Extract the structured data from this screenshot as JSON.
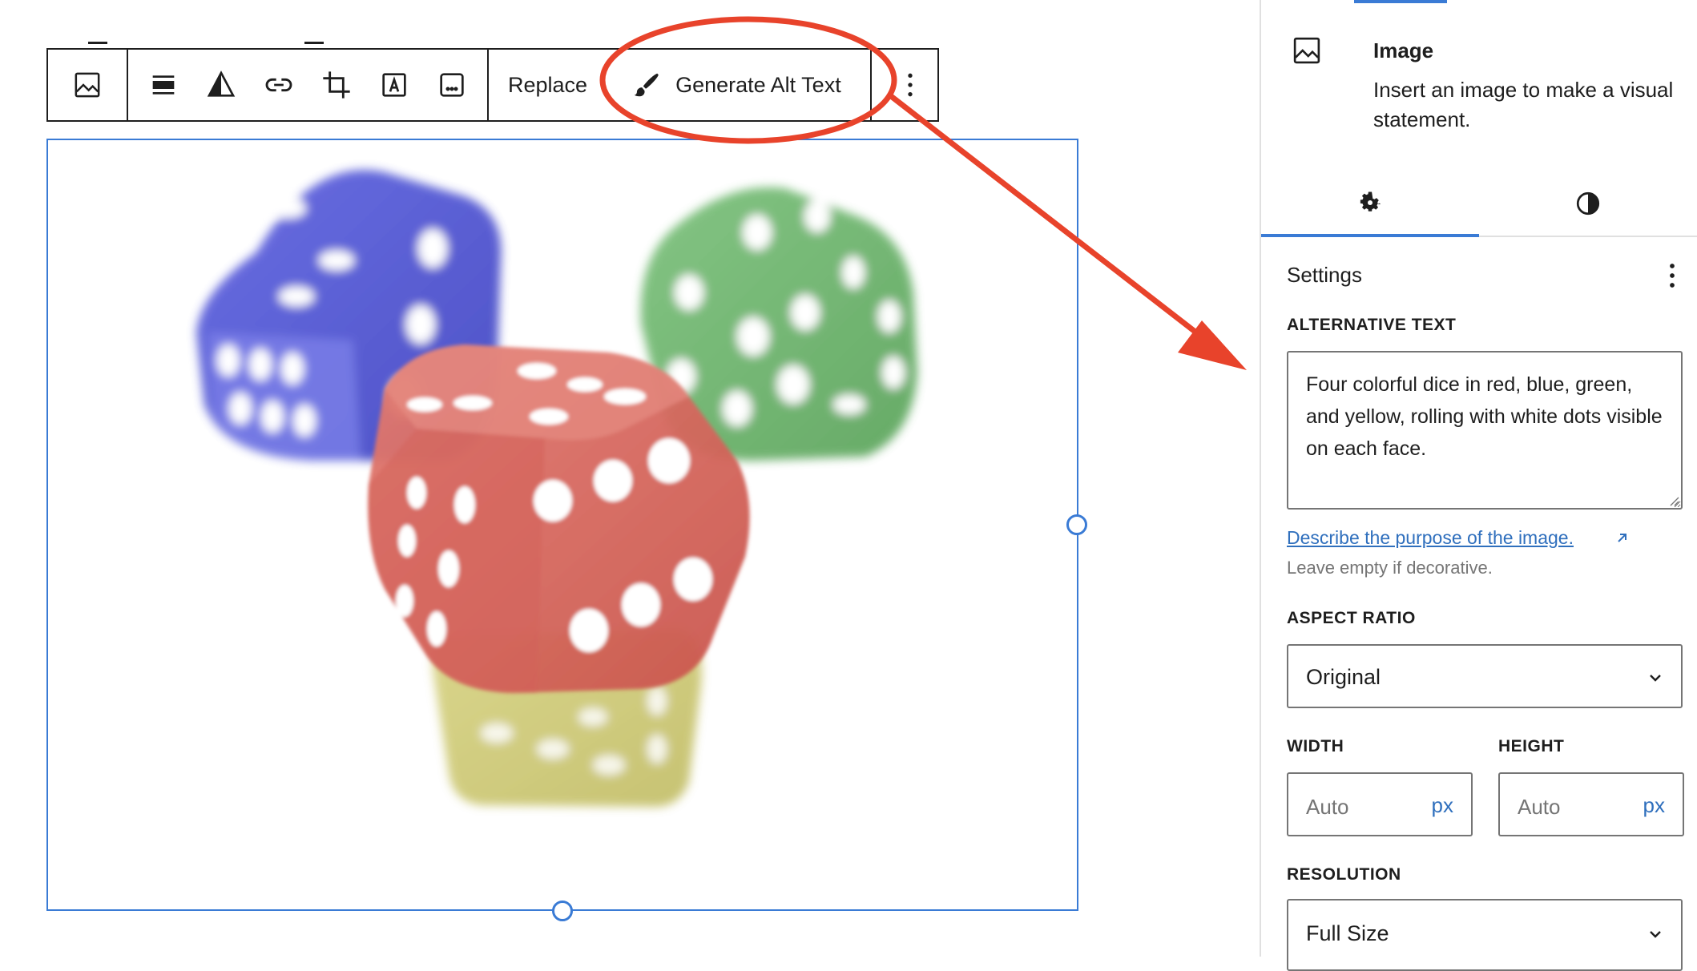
{
  "toolbar": {
    "replace_label": "Replace",
    "generate_alt_text_label": "Generate Alt Text"
  },
  "image_block": {
    "image_description_icons": [
      "image-icon",
      "align-icon",
      "duotone-icon",
      "link-icon",
      "crop-icon",
      "text-overlay-icon",
      "caption-icon"
    ]
  },
  "sidebar": {
    "block": {
      "title": "Image",
      "description": "Insert an image to make a visual statement."
    },
    "tabs": [
      {
        "name": "settings",
        "icon": "gear-icon",
        "active": true
      },
      {
        "name": "styles",
        "icon": "half-circle-icon",
        "active": false
      }
    ],
    "settings_title": "Settings",
    "alt_text": {
      "label": "ALTERNATIVE TEXT",
      "value": "Four colorful dice in red, blue, green, and yellow, rolling with white dots visible on each face.",
      "help_link": "Describe the purpose of the image.",
      "help_text": "Leave empty if decorative."
    },
    "aspect_ratio": {
      "label": "ASPECT RATIO",
      "value": "Original"
    },
    "width": {
      "label": "WIDTH",
      "placeholder": "Auto",
      "unit": "px"
    },
    "height": {
      "label": "HEIGHT",
      "placeholder": "Auto",
      "unit": "px"
    },
    "resolution": {
      "label": "RESOLUTION",
      "value": "Full Size"
    }
  },
  "colors": {
    "accent": "#3a7bd5",
    "annotation": "#e8432b",
    "die_blue": "#4a4fd6",
    "die_green": "#5dac5d",
    "die_red": "#d9635a",
    "die_yellow": "#c9c468"
  }
}
